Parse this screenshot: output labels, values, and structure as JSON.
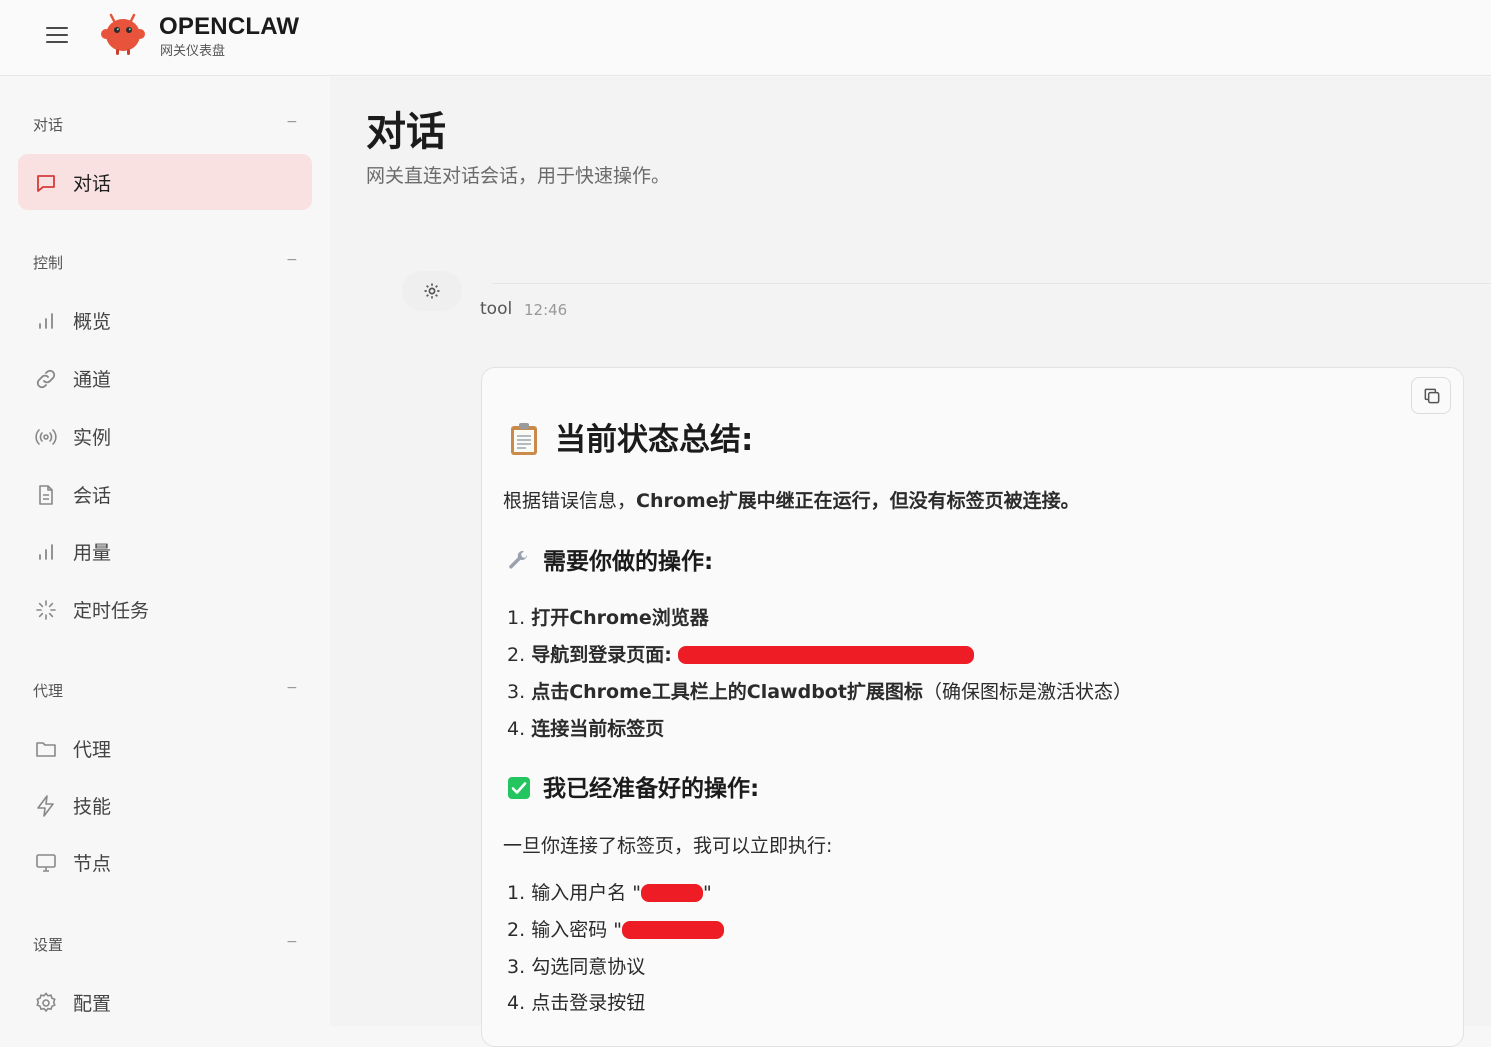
{
  "header": {
    "brand_title": "OPENCLAW",
    "brand_subtitle": "网关仪表盘"
  },
  "sidebar": {
    "sections": [
      {
        "title": "对话",
        "collapse": "−"
      },
      {
        "title": "控制",
        "collapse": "−"
      },
      {
        "title": "代理",
        "collapse": "−"
      },
      {
        "title": "设置",
        "collapse": "−"
      }
    ],
    "items": [
      {
        "label": "对话",
        "icon": "message-square-icon",
        "active": true
      },
      {
        "label": "概览",
        "icon": "bar-chart-icon"
      },
      {
        "label": "通道",
        "icon": "link-icon"
      },
      {
        "label": "实例",
        "icon": "radio-icon"
      },
      {
        "label": "会话",
        "icon": "file-text-icon"
      },
      {
        "label": "用量",
        "icon": "bar-chart-icon"
      },
      {
        "label": "定时任务",
        "icon": "loader-icon"
      },
      {
        "label": "代理",
        "icon": "folder-icon"
      },
      {
        "label": "技能",
        "icon": "zap-icon"
      },
      {
        "label": "节点",
        "icon": "monitor-icon"
      },
      {
        "label": "配置",
        "icon": "gear-icon"
      }
    ]
  },
  "main": {
    "title": "对话",
    "subtitle": "网关直连对话会话，用于快速操作。"
  },
  "message": {
    "sender": "tool",
    "time": "12:46",
    "heading": "当前状态总结:",
    "intro_prefix": "根据错误信息，",
    "intro_bold": "Chrome扩展中继正在运行，但没有标签页被连接。",
    "todo_heading": "需要你做的操作:",
    "todo": [
      {
        "num": "1.",
        "bold": "打开Chrome浏览器",
        "rest": ""
      },
      {
        "num": "2.",
        "bold": "导航到登录页面:",
        "rest": ""
      },
      {
        "num": "3.",
        "bold": "点击Chrome工具栏上的Clawdbot扩展图标",
        "rest": "（确保图标是激活状态）"
      },
      {
        "num": "4.",
        "bold": "连接当前标签页",
        "rest": ""
      }
    ],
    "ready_heading": "我已经准备好的操作:",
    "ready_intro": "一旦你连接了标签页，我可以立即执行:",
    "ready": [
      {
        "num": "1.",
        "text": "输入用户名 \"",
        "suffix": "\""
      },
      {
        "num": "2.",
        "text": "输入密码 \"",
        "suffix": ""
      },
      {
        "num": "3.",
        "text": "勾选同意协议",
        "suffix": ""
      },
      {
        "num": "4.",
        "text": "点击登录按钮",
        "suffix": ""
      }
    ]
  },
  "colors": {
    "active_bg": "#f9e1e1",
    "redaction": "#ee1c24",
    "check_green": "#22c55e",
    "logo_red": "#e8533c"
  }
}
